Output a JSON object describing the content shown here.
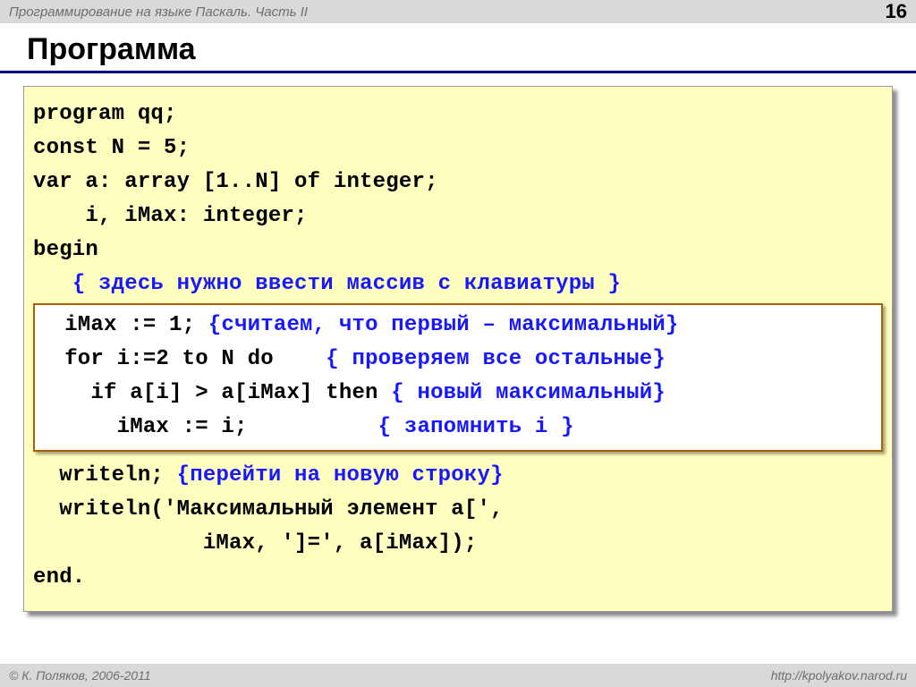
{
  "header": {
    "subject": "Программирование на языке Паскаль. Часть II",
    "page": "16"
  },
  "title": "Программа",
  "code": {
    "l1": "program qq;",
    "l2": "const N = 5;",
    "l3": "var a: array [1..N] of integer;",
    "l4": "    i, iMax: integer;",
    "l5": "begin",
    "l6a": "   ",
    "l6b": "{ здесь нужно ввести массив с клавиатуры }",
    "b1a": "  iMax := 1; ",
    "b1b": "{считаем, что первый – максимальный}",
    "b2a": "  for i:=2 to N do    ",
    "b2b": "{ проверяем все остальные}",
    "b3a": "    if a[i] > a[iMax] then ",
    "b3b": "{ новый максимальный}",
    "b4a": "      iMax := i;          ",
    "b4b": "{ запомнить i }",
    "l7a": "  writeln; ",
    "l7b": "{перейти на новую строку}",
    "l8": "  writeln('Максимальный элемент a[',",
    "l9": "             iMax, ']=', a[iMax]);",
    "l10": "end."
  },
  "footer": {
    "copyright": "© К. Поляков, 2006-2011",
    "url": "http://kpolyakov.narod.ru"
  }
}
